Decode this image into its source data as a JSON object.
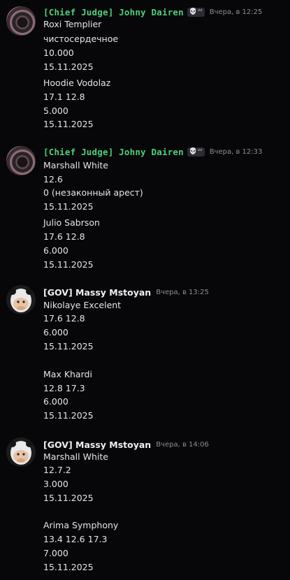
{
  "messages": [
    {
      "author": "[Chief Judge] Johny Dairen",
      "timestamp": "Вчера, в 12:25",
      "badge_icon": "skull-icon",
      "badge_text": "ᶻᶻ",
      "lines": [
        "Roxi Templier",
        "чистосердечное",
        "10.000",
        "15.11.2025",
        "Hoodie Vodolaz",
        "17.1 12.8",
        "5.000",
        "15.11.2025"
      ]
    },
    {
      "author": "[Chief Judge] Johny Dairen",
      "timestamp": "Вчера, в 12:33",
      "badge_icon": "skull-icon",
      "badge_text": "ᶻᶻ",
      "lines": [
        "Marshall White",
        "12.6",
        "0 (незаконный арест)",
        "15.11.2025",
        "Julio Sabrson",
        "17.6 12.8",
        "6.000",
        "15.11.2025"
      ]
    },
    {
      "author": "[GOV] Massy Mstoyan",
      "timestamp": "Вчера, в 13:25",
      "lines": [
        "Nikolaye Excelent",
        "17.6 12.8",
        "6.000",
        "15.11.2025",
        "Max Khardi",
        "12.8 17.3",
        "6.000",
        "15.11.2025"
      ]
    },
    {
      "author": "[GOV] Massy Mstoyan",
      "timestamp": "Вчера, в 14:06",
      "lines": [
        "Marshall White",
        "12.7.2",
        "3.000",
        "15.11.2025",
        "Arima Symphony",
        "13.4 12.6 17.3",
        "7.000",
        "15.11.2025"
      ]
    }
  ]
}
